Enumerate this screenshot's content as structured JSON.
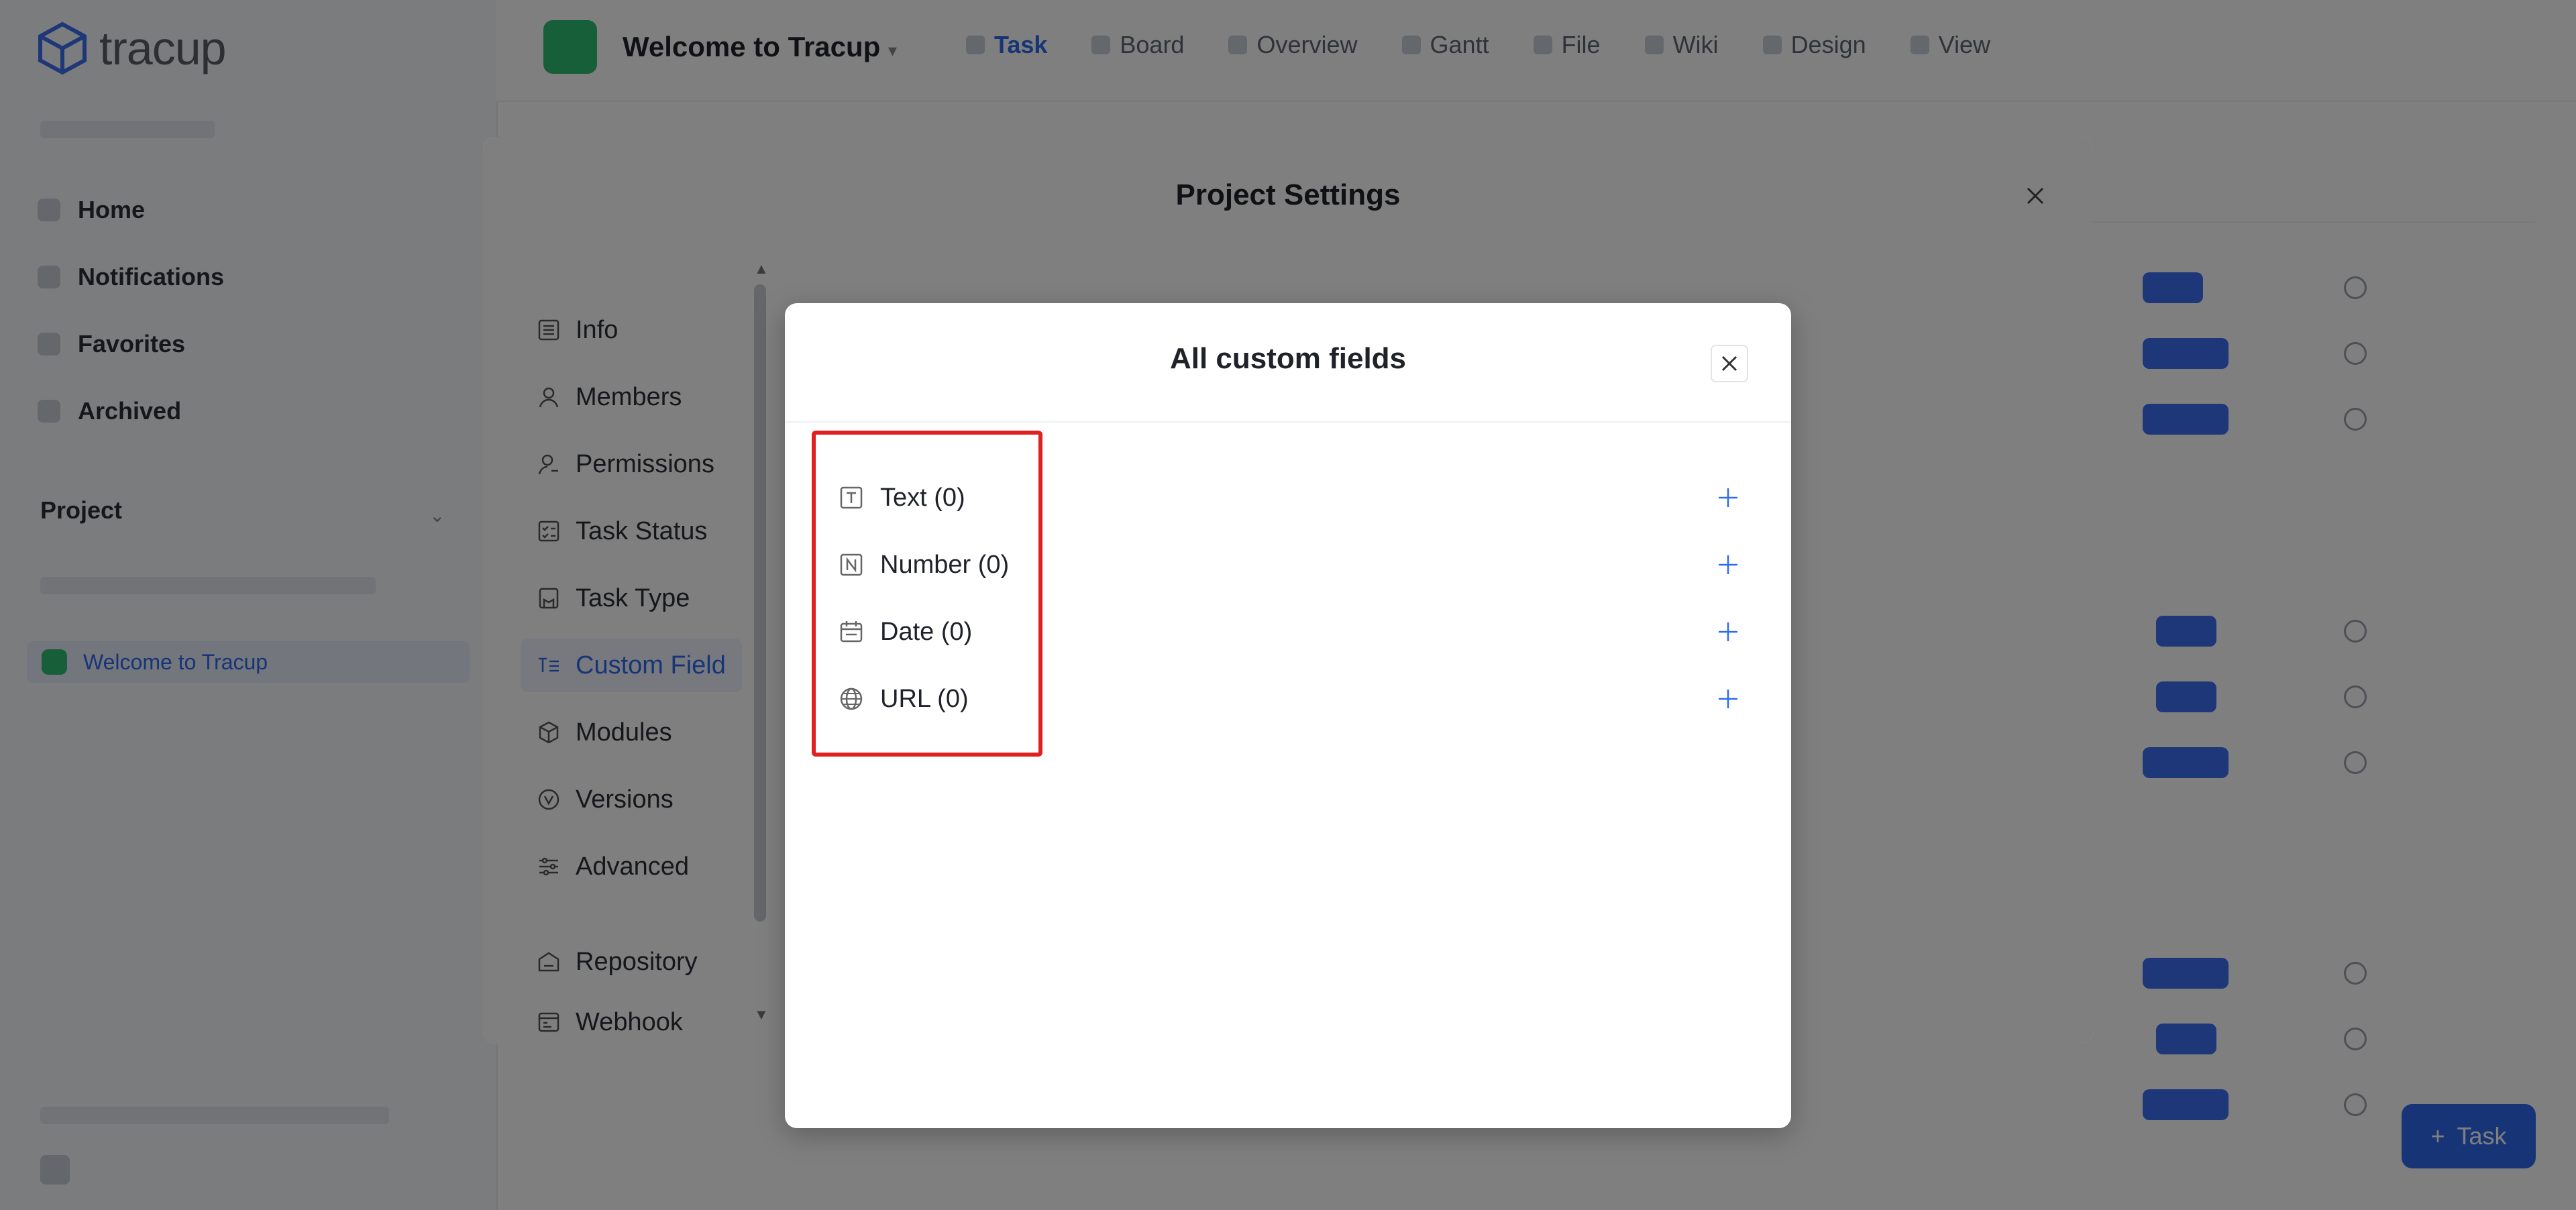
{
  "app": {
    "logo_text": "tracup",
    "sidebar": {
      "items": [
        {
          "label": "Home",
          "icon": "home-icon"
        },
        {
          "label": "Notifications",
          "icon": "bell-icon"
        },
        {
          "label": "Favorites",
          "icon": "star-icon"
        },
        {
          "label": "Archived",
          "icon": "archive-icon"
        }
      ],
      "section_label": "Project",
      "project_item": "Welcome to Tracup"
    },
    "header": {
      "project_title": "Welcome to Tracup",
      "tabs": [
        "Task",
        "Board",
        "Overview",
        "Gantt",
        "File",
        "Wiki",
        "Design",
        "View"
      ],
      "active_tab": 0
    },
    "fab_label": "Task"
  },
  "settings_modal": {
    "title": "Project Settings",
    "menu": [
      {
        "label": "Info",
        "icon": "info-list-icon"
      },
      {
        "label": "Members",
        "icon": "person-icon"
      },
      {
        "label": "Permissions",
        "icon": "person-key-icon"
      },
      {
        "label": "Task Status",
        "icon": "status-icon"
      },
      {
        "label": "Task Type",
        "icon": "flag-icon"
      },
      {
        "label": "Custom Field",
        "icon": "text-lines-icon"
      },
      {
        "label": "Modules",
        "icon": "cube-icon"
      },
      {
        "label": "Versions",
        "icon": "version-icon"
      },
      {
        "label": "Advanced",
        "icon": "sliders-icon"
      },
      {
        "label": "Repository",
        "icon": "repository-icon"
      },
      {
        "label": "Webhook",
        "icon": "webhook-icon"
      }
    ],
    "active_item": "Custom Field"
  },
  "dialog": {
    "title": "All custom fields",
    "fields": [
      {
        "label": "Text (0)",
        "icon": "text-field-icon"
      },
      {
        "label": "Number (0)",
        "icon": "number-field-icon"
      },
      {
        "label": "Date (0)",
        "icon": "calendar-icon"
      },
      {
        "label": "URL (0)",
        "icon": "globe-icon"
      }
    ]
  },
  "colors": {
    "accent": "#2f6bed",
    "highlight": "#e02020",
    "project_green": "#2fbf71"
  }
}
